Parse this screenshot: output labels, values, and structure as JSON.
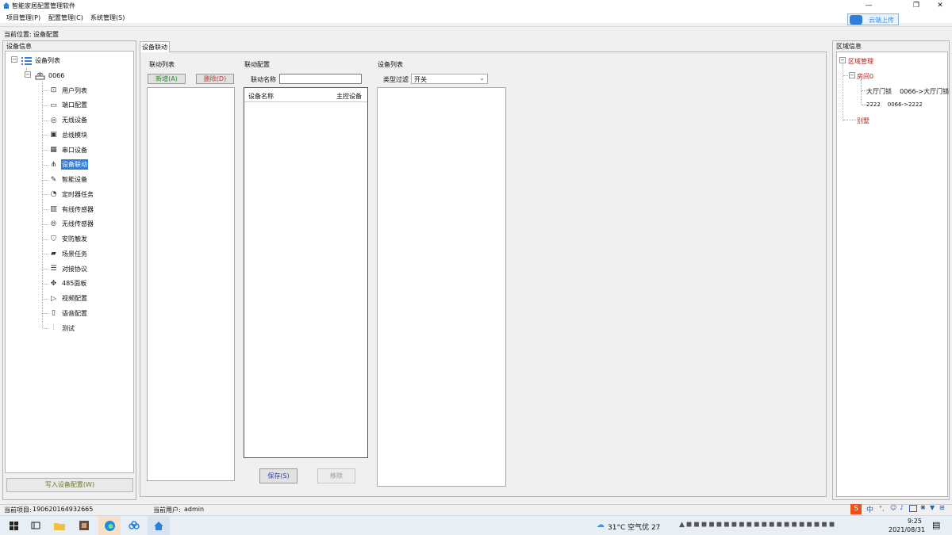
{
  "window": {
    "title": "智能家居配置管理软件",
    "controls": {
      "minimize": "—",
      "maximize": "❐",
      "close": "✕"
    }
  },
  "menu": [
    "项目管理(P)",
    "配置管理(C)",
    "系统管理(S)"
  ],
  "cloud_button": {
    "label": "云端上传"
  },
  "location": {
    "label": "当前位置:",
    "value": "设备配置"
  },
  "left_panel": {
    "title": "设备信息",
    "tree_root": "设备列表",
    "device": "0066",
    "items": [
      {
        "label": "用户列表",
        "icon": "user-card-icon"
      },
      {
        "label": "端口配置",
        "icon": "port-icon"
      },
      {
        "label": "无线设备",
        "icon": "wireless-icon"
      },
      {
        "label": "总线模块",
        "icon": "bus-module-icon"
      },
      {
        "label": "串口设备",
        "icon": "serial-icon"
      },
      {
        "label": "设备联动",
        "icon": "linkage-icon"
      },
      {
        "label": "智能设备",
        "icon": "smart-device-icon"
      },
      {
        "label": "定时器任务",
        "icon": "timer-icon"
      },
      {
        "label": "有线传感器",
        "icon": "wired-sensor-icon"
      },
      {
        "label": "无线传感器",
        "icon": "wireless-sensor-icon"
      },
      {
        "label": "安防触发",
        "icon": "shield-icon"
      },
      {
        "label": "场景任务",
        "icon": "scene-icon"
      },
      {
        "label": "对接协议",
        "icon": "protocol-icon"
      },
      {
        "label": "485面板",
        "icon": "panel-icon"
      },
      {
        "label": "视频配置",
        "icon": "video-icon"
      },
      {
        "label": "语音配置",
        "icon": "voice-icon"
      },
      {
        "label": "测试",
        "icon": "test-icon"
      }
    ],
    "selected_index": 5,
    "import_button": "写入设备配置(W)"
  },
  "center": {
    "tab": "设备联动",
    "link_list": {
      "title": "联动列表",
      "add": "新增(A)",
      "delete": "删除(D)"
    },
    "link_config": {
      "title": "联动配置",
      "name_label": "联动名称",
      "name_value": "",
      "columns": [
        "设备名称",
        "主控设备"
      ],
      "save": "保存(S)",
      "remove": "移除"
    },
    "device_list": {
      "title": "设备列表",
      "filter_label": "类型过滤",
      "filter_value": "开关"
    }
  },
  "right_panel": {
    "title": "区域信息",
    "root": "区域管理",
    "room": "房间0",
    "entries": [
      {
        "name": "大厅门锁",
        "mapping": "0066->大厅门锁"
      },
      {
        "name": "2222",
        "mapping": "0066->2222"
      }
    ],
    "other": "别墅"
  },
  "status": {
    "project_label": "当前项目:",
    "project_value": "190620164932665",
    "user_label": "当前用户:",
    "user_value": "admin"
  },
  "taskbar": {
    "weather": "31°C 空气优 27",
    "time": "9:25",
    "date": "2021/08/31",
    "ime": "中"
  },
  "colors": {
    "selection": "#2f7fd8",
    "add_text": "#2a8a2a",
    "delete_text": "#c0392b",
    "region_text": "#b22222"
  }
}
